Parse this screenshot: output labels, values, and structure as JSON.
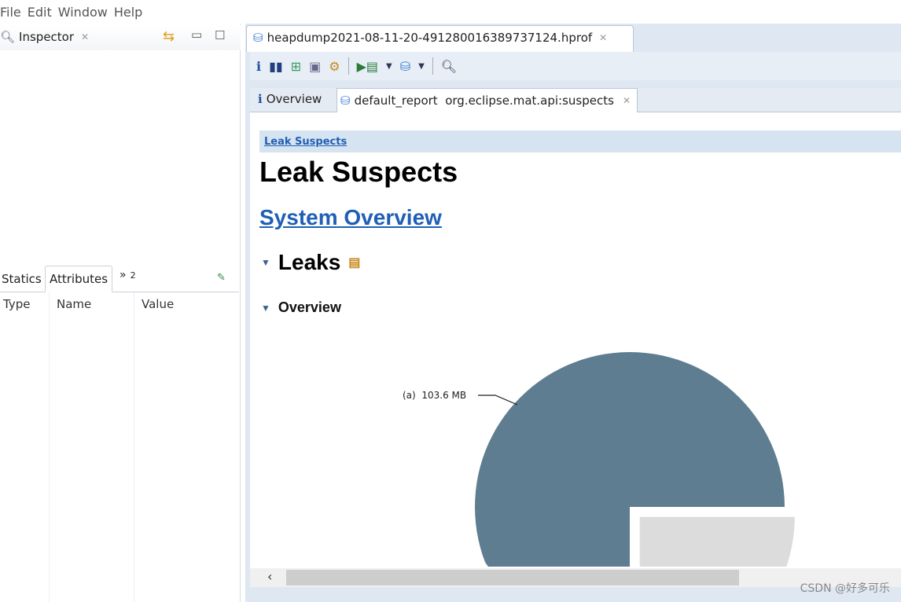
{
  "menu": [
    "File",
    "Edit",
    "Window",
    "Help"
  ],
  "inspector": {
    "title": "Inspector",
    "tabs": [
      "Statics",
      "Attributes"
    ],
    "overflow": "»",
    "overflow_count": "2",
    "columns": [
      "Type",
      "Name",
      "Value"
    ]
  },
  "editor": {
    "tab_title": "heapdump2021-08-11-20-491280016389737124.hprof",
    "inner_tabs": [
      {
        "label": "Overview",
        "icon": "info-icon"
      },
      {
        "label": "default_report  org.eclipse.mat.api:suspects",
        "icon": "report-icon"
      }
    ]
  },
  "report": {
    "breadcrumb": "Leak Suspects",
    "title": "Leak Suspects",
    "system_overview": "System Overview",
    "leaks": "Leaks",
    "overview": "Overview",
    "pie": {
      "label": "(a)  103.6 MB",
      "slices": [
        {
          "label": "(a)",
          "value_mb": 103.6,
          "fraction": 0.75,
          "color": "#5f7d91"
        },
        {
          "fraction": 0.25,
          "color": "#dcdcdc"
        }
      ]
    }
  },
  "watermark": "CSDN @好多可乐"
}
